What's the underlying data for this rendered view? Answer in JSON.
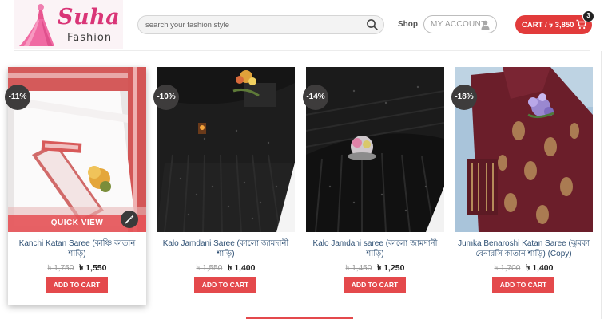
{
  "header": {
    "logo": {
      "title": "Suha",
      "subtitle": "Fashion"
    },
    "search": {
      "placeholder": "search your fashion style",
      "icon": "search-icon"
    },
    "nav": {
      "shop_label": "Shop"
    },
    "account": {
      "label": "MY ACCOUNT",
      "icon": "user-icon"
    },
    "cart": {
      "label": "CART / ৳ 3,850",
      "icon": "cart-icon",
      "count": "3"
    }
  },
  "colors": {
    "accent": "#e4494c",
    "cart": "#e23b3b",
    "badge": "#3e3c3c",
    "title": "#2d4f73",
    "brand": "#d93577"
  },
  "products": [
    {
      "badge": "-11%",
      "title": "Kanchi Katan Saree (কাঞ্চি কাতান শাড়ি)",
      "old_price": "৳ 1,750",
      "price": "৳ 1,550",
      "quick_view": "QUICK VIEW",
      "button": "ADD TO CART"
    },
    {
      "badge": "-10%",
      "title": "Kalo Jamdani Saree (কালো জামদানী শাড়ি)",
      "old_price": "৳ 1,550",
      "price": "৳ 1,400",
      "button": "ADD TO CART"
    },
    {
      "badge": "-14%",
      "title": "Kalo Jamdani saree (কালো জামদানী শাড়ি)",
      "old_price": "৳ 1,450",
      "price": "৳ 1,250",
      "button": "ADD TO CART"
    },
    {
      "badge": "-18%",
      "title": "Jumka Benaroshi Katan Saree (ঝুমকা বেনারসি কাতান শাড়ি) (Copy)",
      "old_price": "৳ 1,700",
      "price": "৳ 1,400",
      "button": "ADD TO CART"
    }
  ]
}
